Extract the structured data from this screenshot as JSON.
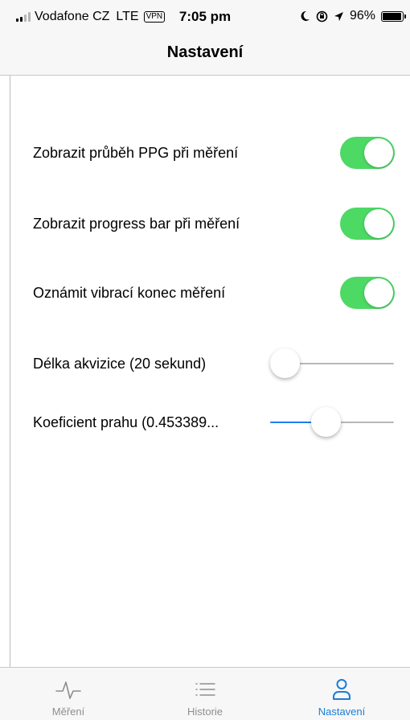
{
  "status_bar": {
    "carrier": "Vodafone CZ",
    "network": "LTE",
    "vpn": "VPN",
    "time": "7:05 pm",
    "battery": "96%",
    "battery_level": 0.96
  },
  "header": {
    "title": "Nastavení"
  },
  "settings": {
    "toggles": [
      {
        "label": "Zobrazit průběh PPG při měření",
        "on": true
      },
      {
        "label": "Zobrazit progress bar při měření",
        "on": true
      },
      {
        "label": "Oznámit vibrací konec měření",
        "on": true
      }
    ],
    "sliders": [
      {
        "label": "Délka akvizice (20 sekund)",
        "value": 0.0
      },
      {
        "label": "Koeficient prahu (0.453389...",
        "value": 0.45
      }
    ]
  },
  "tab_bar": {
    "tabs": [
      {
        "label": "Měření",
        "icon": "pulse-icon",
        "active": false
      },
      {
        "label": "Historie",
        "icon": "list-icon",
        "active": false
      },
      {
        "label": "Nastavení",
        "icon": "person-icon",
        "active": true
      }
    ]
  },
  "colors": {
    "toggle_on": "#4cd964",
    "accent": "#1c7cd6",
    "slider_fill": "#1d7cf2"
  }
}
